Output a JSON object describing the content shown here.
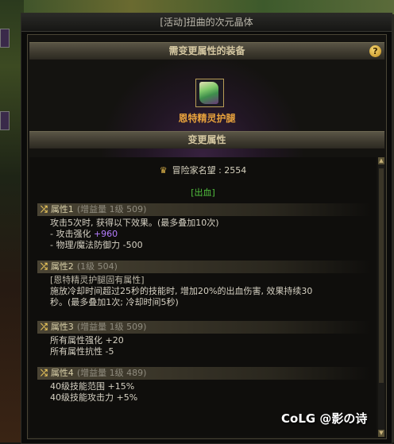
{
  "window": {
    "title": "[活动]扭曲的次元晶体"
  },
  "required_equipment": {
    "header": "需变更属性的装备",
    "help_label": "?",
    "item_name": "恩特精灵护腿",
    "item_icon": "leg-armor-icon"
  },
  "change_attr": {
    "header": "变更属性",
    "reputation_label": "冒险家名望 : 2554",
    "tag": "[出血]"
  },
  "attributes": [
    {
      "title": "属性1",
      "meta": "(增益量 1级 509)",
      "lines": [
        "攻击5次时, 获得以下效果。(最多叠加10次)"
      ],
      "extra": [
        {
          "prefix": "- 攻击强化 ",
          "value": "+960"
        },
        {
          "prefix": "- 物理/魔法防御力 -500",
          "value": ""
        }
      ]
    },
    {
      "title": "属性2",
      "meta": "(1级 504)",
      "fixed": "[恩特精灵护腿固有属性]",
      "lines": [
        "施放冷却时间超过25秒的技能时, 增加20%的出血伤害, 效果持续30",
        "秒。(最多叠加1次; 冷却时间5秒)"
      ]
    },
    {
      "title": "属性3",
      "meta": "(增益量 1级 509)",
      "lines": [
        "所有属性强化 +20",
        "所有属性抗性 -5"
      ]
    },
    {
      "title": "属性4",
      "meta": "(增益量 1级 489)",
      "lines": [
        "40级技能范围 +15%",
        "40级技能攻击力 +5%"
      ]
    }
  ],
  "watermark": "CoLG @影の诗",
  "colors": {
    "accent_gold": "#e8a23c",
    "bleed_green": "#52c13e",
    "value_purple": "#b57cff"
  }
}
